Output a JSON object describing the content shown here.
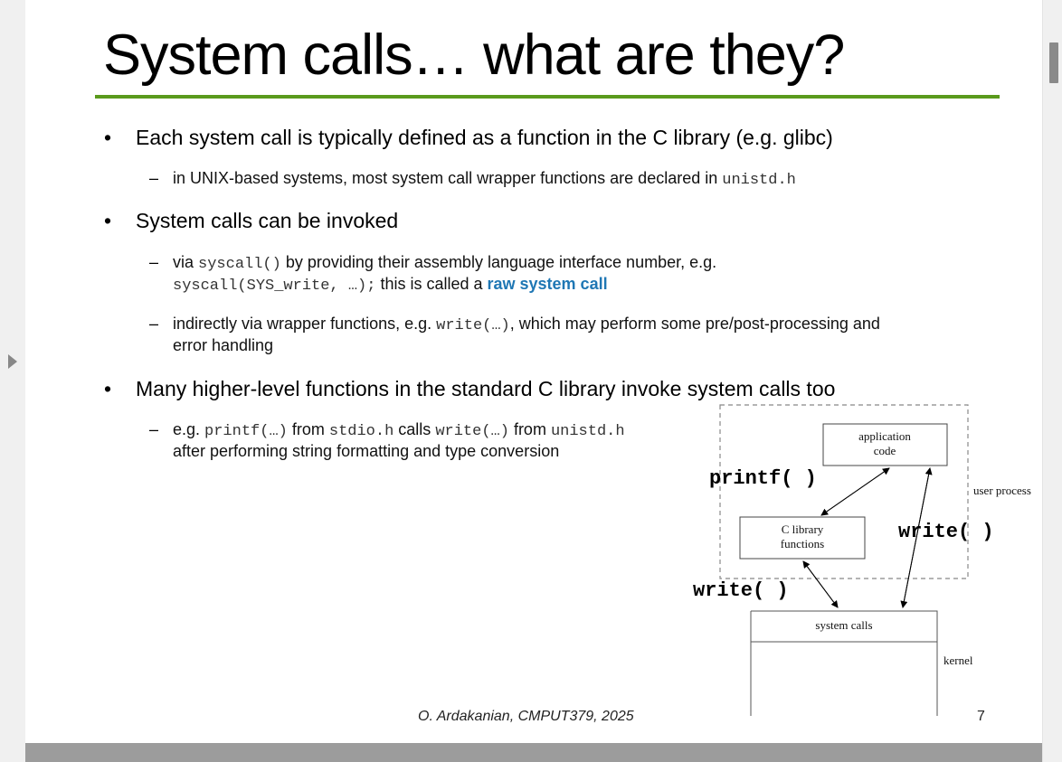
{
  "slide": {
    "title": "System calls… what are they?",
    "bullets": [
      {
        "text": "Each system call is typically defined as a function in the C library (e.g. glibc)",
        "subs": [
          {
            "pre": "in UNIX-based systems, most system call wrapper functions are declared in ",
            "code": "unistd.h"
          }
        ]
      },
      {
        "text": "System calls can be invoked",
        "subs": [
          {
            "pre": "via ",
            "code1": "syscall()",
            "mid": " by providing their assembly language interface number, e.g.",
            "code2": "syscall(SYS_write, …);",
            "post": " this is called a ",
            "link": "raw system call"
          },
          {
            "pre": "indirectly via wrapper functions, e.g. ",
            "code": "write(…)",
            "post": ", which may perform some pre/post-processing and",
            "line2": "error handling"
          }
        ]
      },
      {
        "text": "Many higher-level functions in the standard C library invoke system calls too",
        "subs": [
          {
            "pre": "e.g. ",
            "code1": "printf(…)",
            "t1": " from ",
            "code2": "stdio.h",
            "t2": " calls ",
            "code3": "write(…)",
            "t3": " from ",
            "code4": "unistd.h",
            "line2": "after performing string formatting and type conversion"
          }
        ]
      }
    ],
    "diagram": {
      "application_code": [
        "application",
        "code"
      ],
      "c_library": [
        "C library",
        "functions"
      ],
      "system_calls": "system calls",
      "user_process": "user process",
      "kernel": "kernel",
      "printf_label": "printf( )",
      "write_label_right": "write( )",
      "write_label_left": "write( )"
    },
    "footer": {
      "author": "O. Ardakanian, CMPUT379, 2025",
      "page": "7"
    }
  }
}
